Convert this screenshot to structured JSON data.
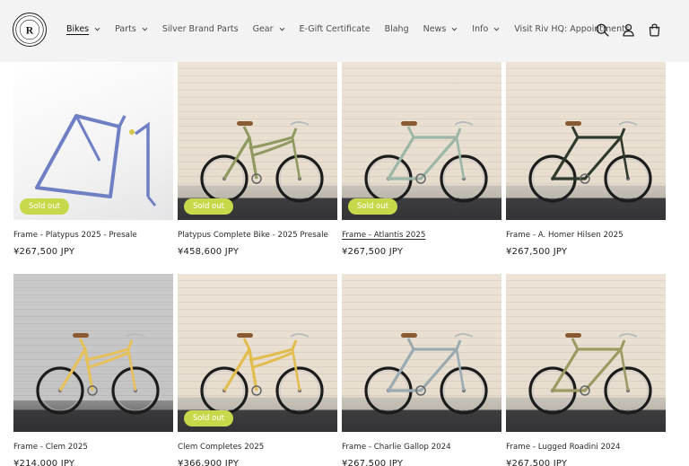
{
  "header": {
    "logo_icon": "riv-logo-icon",
    "nav": [
      {
        "label": "Bikes",
        "dropdown": true,
        "active": true
      },
      {
        "label": "Parts",
        "dropdown": true,
        "active": false
      },
      {
        "label": "Silver Brand Parts",
        "dropdown": false,
        "active": false
      },
      {
        "label": "Gear",
        "dropdown": true,
        "active": false
      },
      {
        "label": "E-Gift Certificate",
        "dropdown": false,
        "active": false
      },
      {
        "label": "Blahg",
        "dropdown": false,
        "active": false
      },
      {
        "label": "News",
        "dropdown": true,
        "active": false
      },
      {
        "label": "Info",
        "dropdown": true,
        "active": false
      },
      {
        "label": "Visit Riv HQ: Appointments",
        "dropdown": false,
        "active": false
      }
    ],
    "icons": [
      "search-icon",
      "account-icon",
      "cart-icon"
    ]
  },
  "products": [
    {
      "title": "Frame - Platypus 2025 - Presale",
      "price": "¥267,500 JPY",
      "badge": "Sold out",
      "bike_color": "#6f7fc4",
      "scene": "studio"
    },
    {
      "title": "Platypus Complete Bike - 2025 Presale",
      "price": "¥458,600 JPY",
      "badge": "Sold out",
      "bike_color": "#8f9960",
      "scene": "wall"
    },
    {
      "title": "Frame - Atlantis 2025",
      "price": "¥267,500 JPY",
      "badge": "Sold out",
      "bike_color": "#9cb6a8",
      "scene": "wall"
    },
    {
      "title": "Frame - A. Homer Hilsen 2025",
      "price": "¥267,500 JPY",
      "badge": "",
      "bike_color": "#2f3a2c",
      "scene": "wall"
    },
    {
      "title": "Frame - Clem 2025",
      "price": "¥214,000 JPY",
      "badge": "",
      "bike_color": "#e6c05a",
      "scene": "greywall"
    },
    {
      "title": "Clem Completes 2025",
      "price": "¥366,900 JPY",
      "badge": "Sold out",
      "bike_color": "#e2bd4e",
      "scene": "wall"
    },
    {
      "title": "Frame - Charlie Gallop 2024",
      "price": "¥267,500 JPY",
      "badge": "",
      "bike_color": "#9aaab0",
      "scene": "wall"
    },
    {
      "title": "Frame - Lugged Roadini 2024",
      "price": "¥267,500 JPY",
      "badge": "",
      "bike_color": "#9a9a62",
      "scene": "wall"
    }
  ],
  "colors": {
    "header_bg": "#f3f3f3",
    "badge_bg": "#c7d94a",
    "text": "#121212"
  }
}
